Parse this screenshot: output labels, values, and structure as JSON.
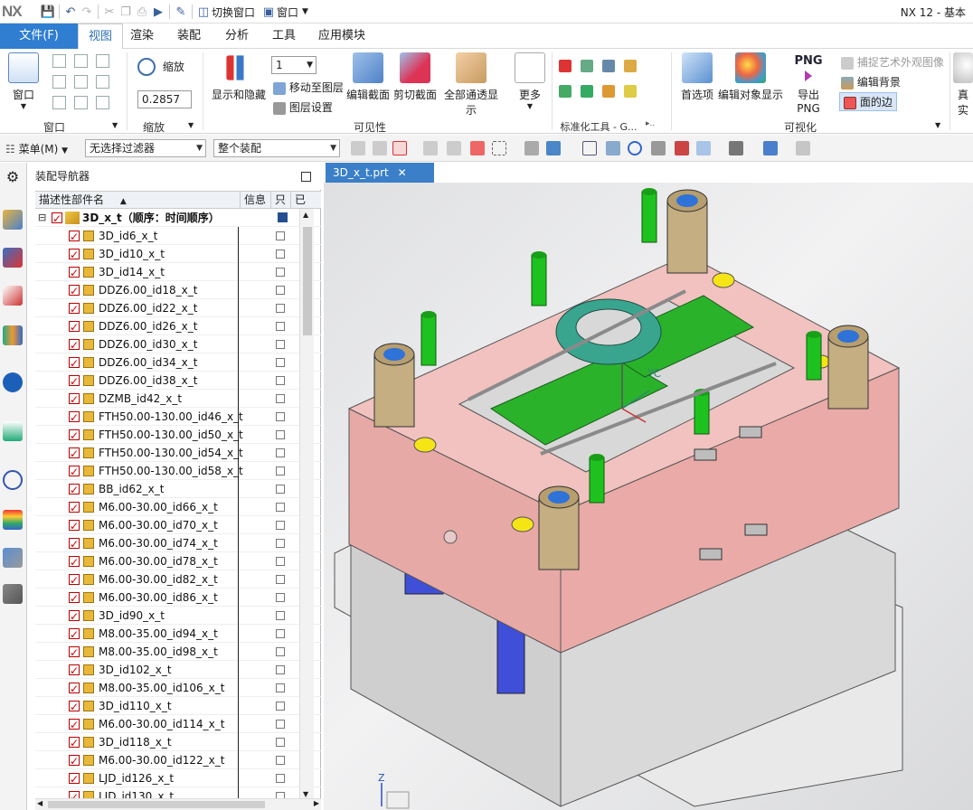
{
  "app": {
    "logo": "NX",
    "title": "NX 12 - 基本",
    "switch_window": "切换窗口",
    "window_menu": "窗口"
  },
  "menu_tabs": [
    "文件(F)",
    "视图",
    "渲染",
    "装配",
    "分析",
    "工具",
    "应用模块"
  ],
  "ribbon": {
    "window_group": {
      "label": "窗口",
      "button": "窗口"
    },
    "zoom_group": {
      "label": "缩放",
      "button": "缩放",
      "value": "0.2857"
    },
    "visibility_group": {
      "label": "可见性",
      "layer_value": "1",
      "show_hide": "显示和隐藏",
      "move_to_layer": "移动至图层",
      "layer_settings": "图层设置",
      "edit_section": "编辑截面",
      "clip_section": "剪切截面",
      "show_all_channels": "全部通透显示",
      "more": "更多"
    },
    "standard_tools": {
      "label": "标准化工具 - G..."
    },
    "visualization_group": {
      "label": "可视化",
      "preferences": "首选项",
      "edit_object_display": "编辑对象显示",
      "export_png": "导出 PNG",
      "png_badge": "PNG",
      "capture_image": "捕捉艺术外观图像",
      "edit_background": "编辑背景",
      "face_edges": "面的边",
      "true_shading": "真实"
    }
  },
  "filterbar": {
    "menu": "菜单(M)",
    "filter": "无选择过滤器",
    "scope": "整个装配"
  },
  "navigator": {
    "title": "装配导航器",
    "col_name": "描述性部件名",
    "col_info": "信息",
    "col_only": "只",
    "col_modified": "已",
    "root": "3D_x_t（顺序：时间顺序）",
    "parts": [
      "3D_id6_x_t",
      "3D_id10_x_t",
      "3D_id14_x_t",
      "DDZ6.00_id18_x_t",
      "DDZ6.00_id22_x_t",
      "DDZ6.00_id26_x_t",
      "DDZ6.00_id30_x_t",
      "DDZ6.00_id34_x_t",
      "DDZ6.00_id38_x_t",
      "DZMB_id42_x_t",
      "FTH50.00-130.00_id46_x_t",
      "FTH50.00-130.00_id50_x_t",
      "FTH50.00-130.00_id54_x_t",
      "FTH50.00-130.00_id58_x_t",
      "BB_id62_x_t",
      "M6.00-30.00_id66_x_t",
      "M6.00-30.00_id70_x_t",
      "M6.00-30.00_id74_x_t",
      "M6.00-30.00_id78_x_t",
      "M6.00-30.00_id82_x_t",
      "M6.00-30.00_id86_x_t",
      "3D_id90_x_t",
      "M8.00-35.00_id94_x_t",
      "M8.00-35.00_id98_x_t",
      "3D_id102_x_t",
      "M8.00-35.00_id106_x_t",
      "3D_id110_x_t",
      "M6.00-30.00_id114_x_t",
      "3D_id118_x_t",
      "M6.00-30.00_id122_x_t",
      "LJD_id126_x_t",
      "LJD_id130_x_t"
    ]
  },
  "viewport": {
    "tab": "3D_x_t.prt",
    "csys_label": "YC",
    "axis_z": "Z"
  }
}
